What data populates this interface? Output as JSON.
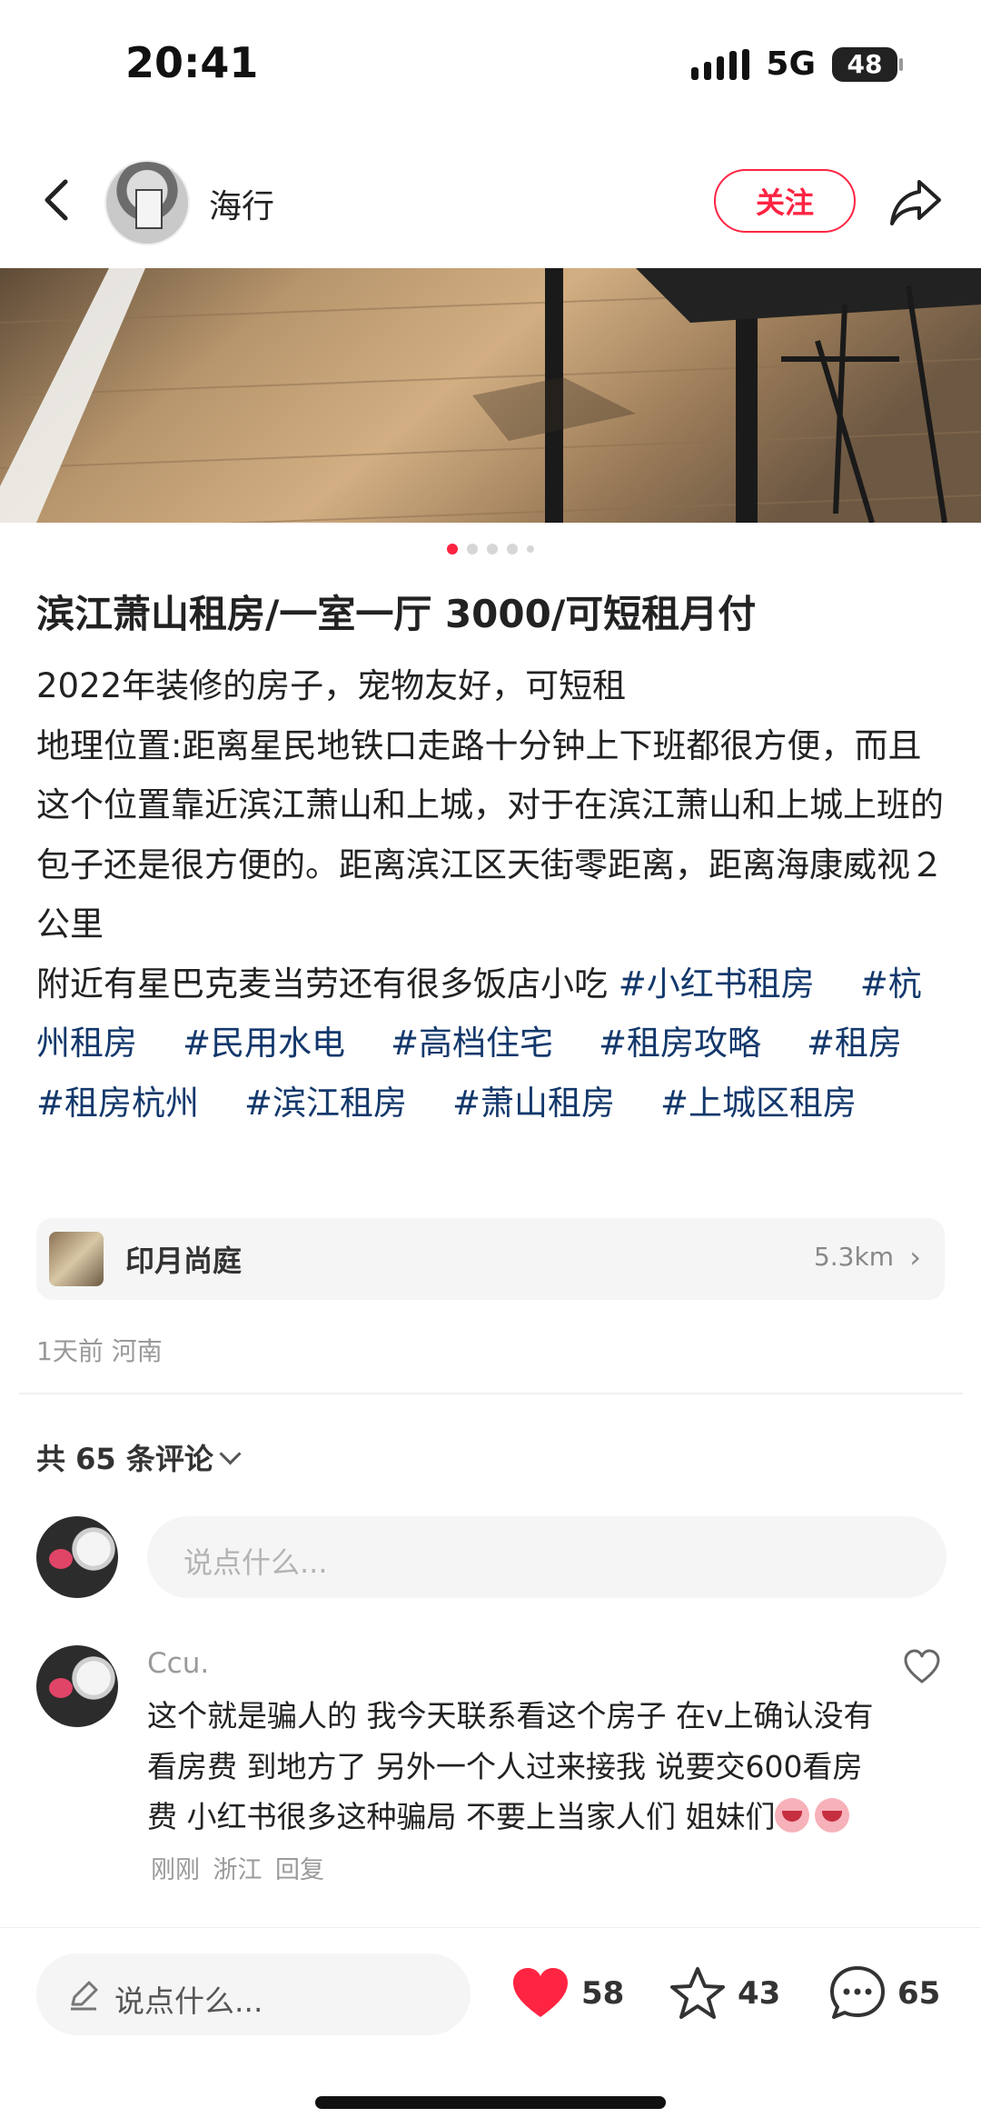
{
  "status_bar": {
    "time": "20:41",
    "network": "5G",
    "battery": "48"
  },
  "nav": {
    "author_name": "海行",
    "follow_label": "关注"
  },
  "carousel": {
    "total_dots": 5,
    "active_index": 0
  },
  "post": {
    "title": "滨江萧山租房/一室一厅 3000/可短租月付",
    "line1": "2022年装修的房子，宠物友好，可短租",
    "line2": "地理位置:距离星民地铁口走路十分钟上下班都很方便，而且这个位置靠近滨江萧山和上城，对于在滨江萧山和上城上班的包子还是很方便的。距离滨江区天街零距离，距离海康威视２公里",
    "line3": "附近有星巴克麦当劳还有很多饭店小吃",
    "tags": [
      "#小红书租房",
      "#杭州租房",
      "#民用水电",
      "#高档住宅",
      "#租房攻略",
      "#租房",
      "#租房杭州",
      "#滨江租房",
      "#萧山租房",
      "#上城区租房"
    ]
  },
  "location": {
    "name": "印月尚庭",
    "distance": "5.3km"
  },
  "meta": {
    "time_place": "1天前 河南"
  },
  "comments": {
    "count_label": "共 65 条评论",
    "input_placeholder": "说点什么...",
    "items": [
      {
        "user": "Ccu.",
        "text": "这个就是骗人的 我今天联系看这个房子 在v上确认没有看房费 到地方了 另外一个人过来接我 说要交600看房费 小红书很多这种骗局 不要上当家人们 姐妹们",
        "emoji": "crying-face",
        "time": "刚刚",
        "location": "浙江",
        "reply_label": "回复"
      }
    ]
  },
  "bottom_bar": {
    "input_placeholder": "说点什么...",
    "like_count": "58",
    "fav_count": "43",
    "comment_count": "65",
    "like_color": "#ff2442"
  }
}
